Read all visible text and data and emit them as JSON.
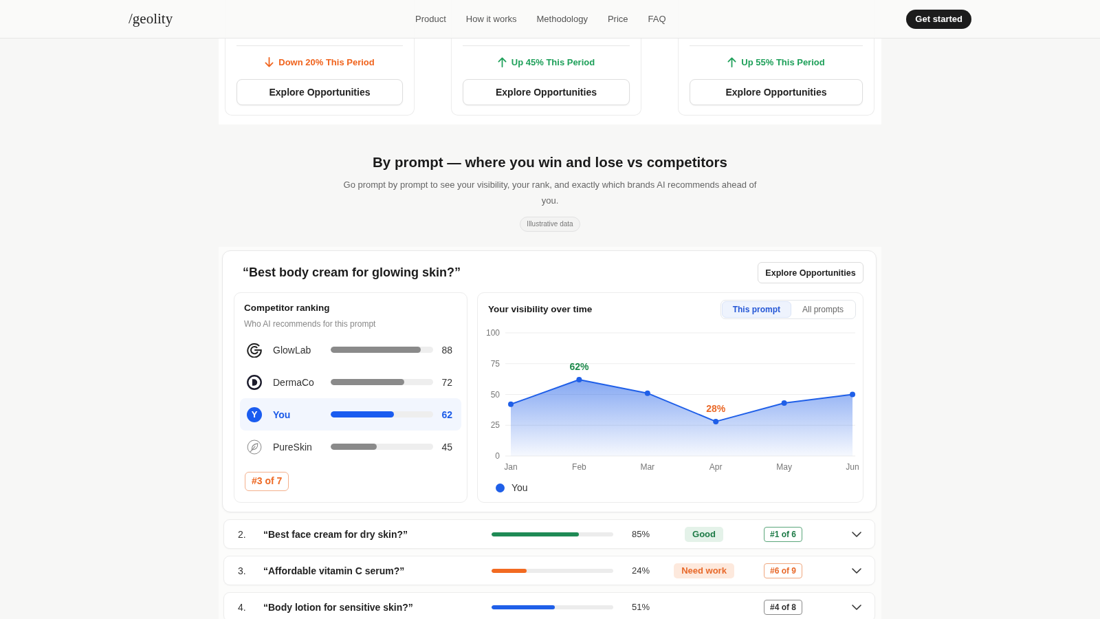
{
  "nav": {
    "logo": "/geolity",
    "links": [
      {
        "label": "Product"
      },
      {
        "label": "How it works"
      },
      {
        "label": "Methodology"
      },
      {
        "label": "Price"
      },
      {
        "label": "FAQ"
      }
    ],
    "cta": "Get started"
  },
  "metric_cards": [
    {
      "kind": "down",
      "change": "Down 20% This Period",
      "button": "Explore Opportunities"
    },
    {
      "kind": "up",
      "change": "Up 45% This Period",
      "button": "Explore Opportunities"
    },
    {
      "kind": "up",
      "change": "Up 55% This Period",
      "button": "Explore Opportunities"
    }
  ],
  "section": {
    "title": "By prompt — where you win and lose vs competitors",
    "subtitle": "Go prompt by prompt to see your visibility, your rank, and exactly which brands AI recommends ahead of you.",
    "badge": "Illustrative data"
  },
  "featured": {
    "prompt": "“Best body cream for glowing skin?”",
    "button": "Explore Opportunities",
    "ranking": {
      "title": "Competitor ranking",
      "subtitle": "Who AI recommends for this prompt",
      "items": [
        {
          "kind": "g-arcs",
          "name": "GlowLab",
          "level": 0.88,
          "score": "88",
          "highlighted": false
        },
        {
          "kind": "d-ring",
          "name": "DermaCo",
          "level": 0.72,
          "score": "72",
          "highlighted": false
        },
        {
          "kind": "letter",
          "avatar": "Y",
          "name": "You",
          "level": 0.62,
          "score": "62",
          "highlighted": true
        },
        {
          "kind": "leaf",
          "name": "PureSkin",
          "level": 0.45,
          "score": "45",
          "highlighted": false
        }
      ],
      "rank": "#3 of 7"
    },
    "visibility": {
      "title": "Your visibility over time",
      "tabs": [
        {
          "label": "This prompt",
          "selected": true
        },
        {
          "label": "All prompts",
          "selected": false
        }
      ],
      "chart_data": [
        {
          "type": "area",
          "categories": [
            "Jan",
            "Feb",
            "Mar",
            "Apr",
            "May",
            "Jun"
          ],
          "ylim": [
            0,
            100
          ],
          "yticks": [
            0,
            25,
            50,
            75,
            100
          ],
          "grid": true,
          "marker": "circle",
          "legend": "bottom-left",
          "series": [
            {
              "name": "You",
              "color": "#1f5fe8",
              "values": [
                42,
                62,
                51,
                28,
                43,
                50
              ]
            }
          ],
          "annotations": [
            "62%",
            "28%"
          ]
        }
      ]
    }
  },
  "prompt_rows": [
    {
      "number": "2.",
      "prompt": "“Best face cream for dry skin?”",
      "level": 0.72,
      "color": "#1f8a55",
      "percent": "85%",
      "kind": "good",
      "status": "Good",
      "rank": "#1 of 6"
    },
    {
      "number": "3.",
      "prompt": "“Affordable vitamin C serum?”",
      "level": 0.29,
      "color": "#f26a21",
      "percent": "24%",
      "kind": "warn",
      "status": "Need work",
      "rank": "#6 of 9"
    },
    {
      "number": "4.",
      "prompt": "“Body lotion for sensitive skin?”",
      "level": 0.52,
      "color": "#1f5fe8",
      "percent": "51%",
      "kind": "neutral",
      "rank": "#4 of 8"
    }
  ]
}
